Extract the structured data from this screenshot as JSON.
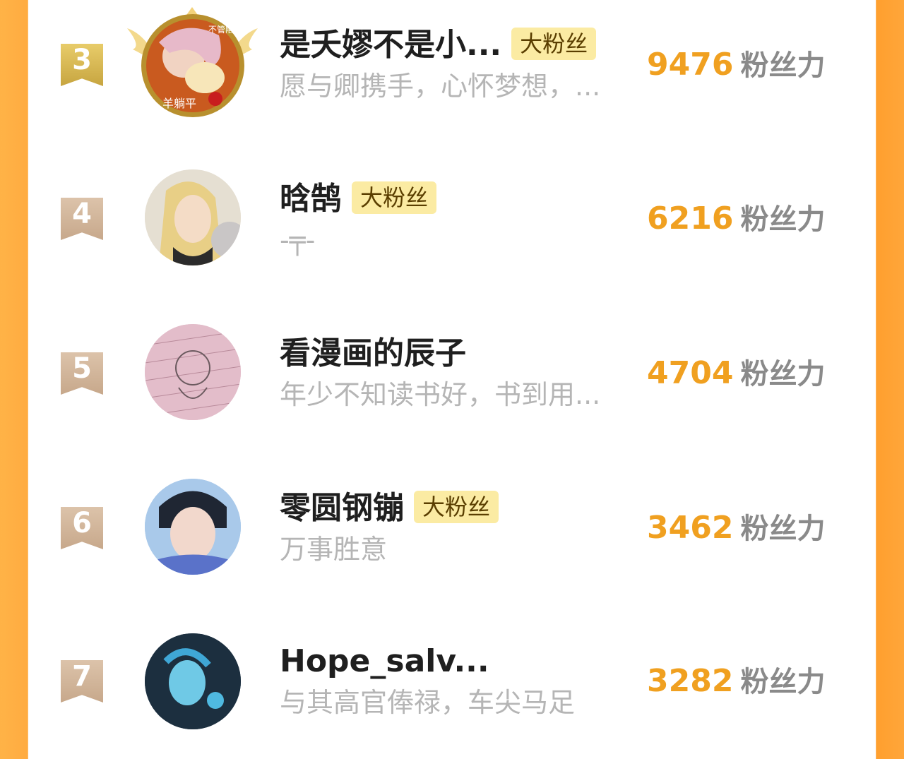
{
  "score_unit": "粉丝力",
  "badge_label": "大粉丝",
  "rows": [
    {
      "rank": "3",
      "name": "是夭嫪不是小...",
      "badge": true,
      "signature": "愿与卿携手，心怀梦想，...",
      "score": "9476",
      "avatar_text_top": "不管陷",
      "avatar_text_bottom": "羊躺平"
    },
    {
      "rank": "4",
      "name": "晗鹄",
      "badge": true,
      "signature": "-╤-",
      "score": "6216"
    },
    {
      "rank": "5",
      "name": "看漫画的辰子",
      "badge": false,
      "signature": "年少不知读书好，书到用...",
      "score": "4704"
    },
    {
      "rank": "6",
      "name": "零圆钢镚",
      "badge": true,
      "signature": "万事胜意",
      "score": "3462"
    },
    {
      "rank": "7",
      "name": "Hope_salv...",
      "badge": false,
      "signature": "与其高官俸禄，车尖马足",
      "score": "3282"
    }
  ],
  "colors": {
    "accent": "#f0a020",
    "gold": "#d4b24e",
    "rank_bg": "#cfb295",
    "badge_bg": "#fbeba3"
  }
}
